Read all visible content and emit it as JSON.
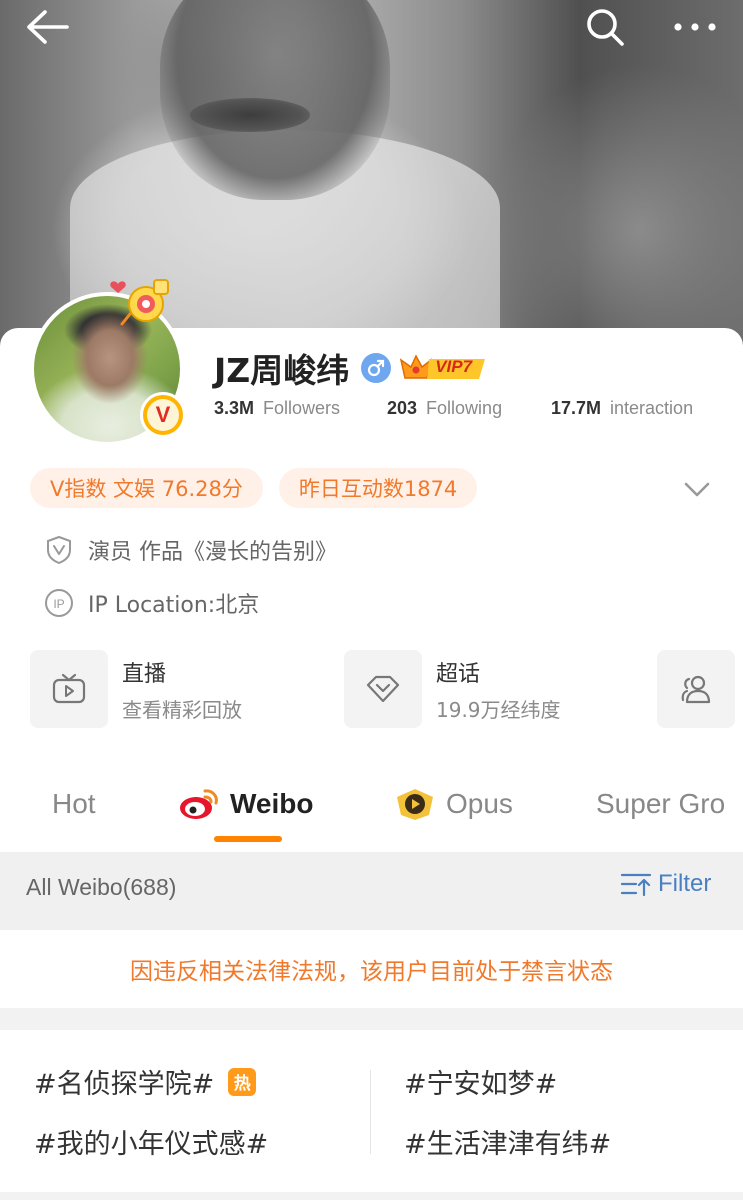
{
  "header": {
    "back_icon": "back-arrow-icon",
    "search_icon": "search-icon",
    "more_icon": "more-dots-icon"
  },
  "profile": {
    "username": "JZ周峻纬",
    "gender": "male",
    "vip_label": "VIP7",
    "verified_mark": "V",
    "stats": [
      {
        "value": "3.3M",
        "label": "Followers"
      },
      {
        "value": "203",
        "label": "Following"
      },
      {
        "value": "17.7M",
        "label": "interaction"
      }
    ],
    "pills": [
      "V指数 文娱 76.28分",
      "昨日互动数1874"
    ],
    "bio": "演员 作品《漫长的告别》",
    "ip_location": "IP Location:北京"
  },
  "entries": [
    {
      "title": "直播",
      "subtitle": "查看精彩回放",
      "icon": "tv-icon"
    },
    {
      "title": "超话",
      "subtitle": "19.9万经纬度",
      "icon": "diamond-icon"
    },
    {
      "title": "",
      "subtitle": "",
      "icon": "group-users-icon"
    }
  ],
  "tabs": [
    {
      "label": "Hot",
      "active": false
    },
    {
      "label": "Weibo",
      "active": true
    },
    {
      "label": "Opus",
      "active": false
    },
    {
      "label": "Super Gro",
      "active": false
    }
  ],
  "feed": {
    "all_label": "All Weibo(688)",
    "filter_label": "Filter",
    "notice": "因违反相关法律法规，该用户目前处于禁言状态"
  },
  "topics": [
    {
      "text": "#名侦探学院#",
      "badge": "热"
    },
    {
      "text": "#宁安如梦#",
      "badge": ""
    },
    {
      "text": "#我的小年仪式感#",
      "badge": ""
    },
    {
      "text": "#生活津津有纬#",
      "badge": ""
    }
  ],
  "colors": {
    "accent_orange": "#ff8200",
    "pill_text": "#f0792b",
    "pill_bg": "#fff1e8",
    "filter_blue": "#4a7fc1"
  }
}
